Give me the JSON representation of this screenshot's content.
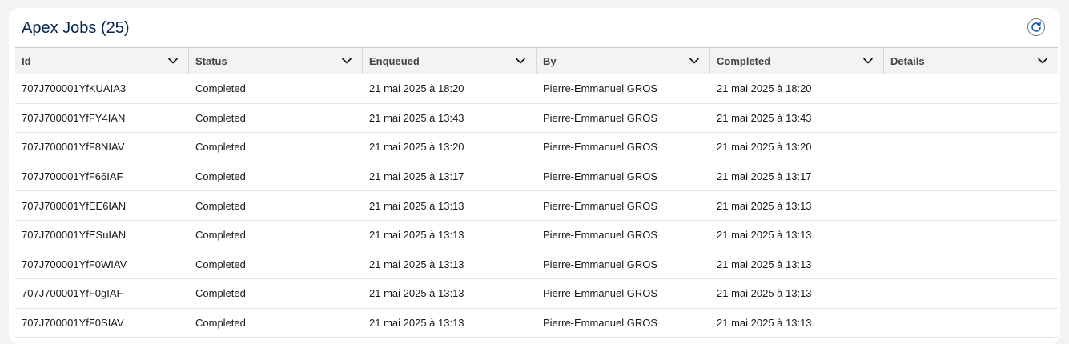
{
  "card": {
    "title": "Apex Jobs (25)",
    "refresh_icon": "refresh-icon"
  },
  "table": {
    "columns": [
      {
        "label": "Id"
      },
      {
        "label": "Status"
      },
      {
        "label": "Enqueued"
      },
      {
        "label": "By"
      },
      {
        "label": "Completed"
      },
      {
        "label": "Details"
      }
    ],
    "rows": [
      {
        "id": "707J700001YfKUAIA3",
        "status": "Completed",
        "enqueued": "21 mai 2025 à 18:20",
        "by": "Pierre-Emmanuel GROS",
        "completed": "21 mai 2025 à 18:20",
        "details": ""
      },
      {
        "id": "707J700001YfFY4IAN",
        "status": "Completed",
        "enqueued": "21 mai 2025 à 13:43",
        "by": "Pierre-Emmanuel GROS",
        "completed": "21 mai 2025 à 13:43",
        "details": ""
      },
      {
        "id": "707J700001YfF8NIAV",
        "status": "Completed",
        "enqueued": "21 mai 2025 à 13:20",
        "by": "Pierre-Emmanuel GROS",
        "completed": "21 mai 2025 à 13:20",
        "details": ""
      },
      {
        "id": "707J700001YfF66IAF",
        "status": "Completed",
        "enqueued": "21 mai 2025 à 13:17",
        "by": "Pierre-Emmanuel GROS",
        "completed": "21 mai 2025 à 13:17",
        "details": ""
      },
      {
        "id": "707J700001YfEE6IAN",
        "status": "Completed",
        "enqueued": "21 mai 2025 à 13:13",
        "by": "Pierre-Emmanuel GROS",
        "completed": "21 mai 2025 à 13:13",
        "details": ""
      },
      {
        "id": "707J700001YfESuIAN",
        "status": "Completed",
        "enqueued": "21 mai 2025 à 13:13",
        "by": "Pierre-Emmanuel GROS",
        "completed": "21 mai 2025 à 13:13",
        "details": ""
      },
      {
        "id": "707J700001YfF0WIAV",
        "status": "Completed",
        "enqueued": "21 mai 2025 à 13:13",
        "by": "Pierre-Emmanuel GROS",
        "completed": "21 mai 2025 à 13:13",
        "details": ""
      },
      {
        "id": "707J700001YfF0gIAF",
        "status": "Completed",
        "enqueued": "21 mai 2025 à 13:13",
        "by": "Pierre-Emmanuel GROS",
        "completed": "21 mai 2025 à 13:13",
        "details": ""
      },
      {
        "id": "707J700001YfF0SIAV",
        "status": "Completed",
        "enqueued": "21 mai 2025 à 13:13",
        "by": "Pierre-Emmanuel GROS",
        "completed": "21 mai 2025 à 13:13",
        "details": ""
      }
    ]
  },
  "colors": {
    "title": "#03234d",
    "accent": "#0b5cab",
    "header_bg": "#f3f3f3",
    "text": "#181818"
  }
}
